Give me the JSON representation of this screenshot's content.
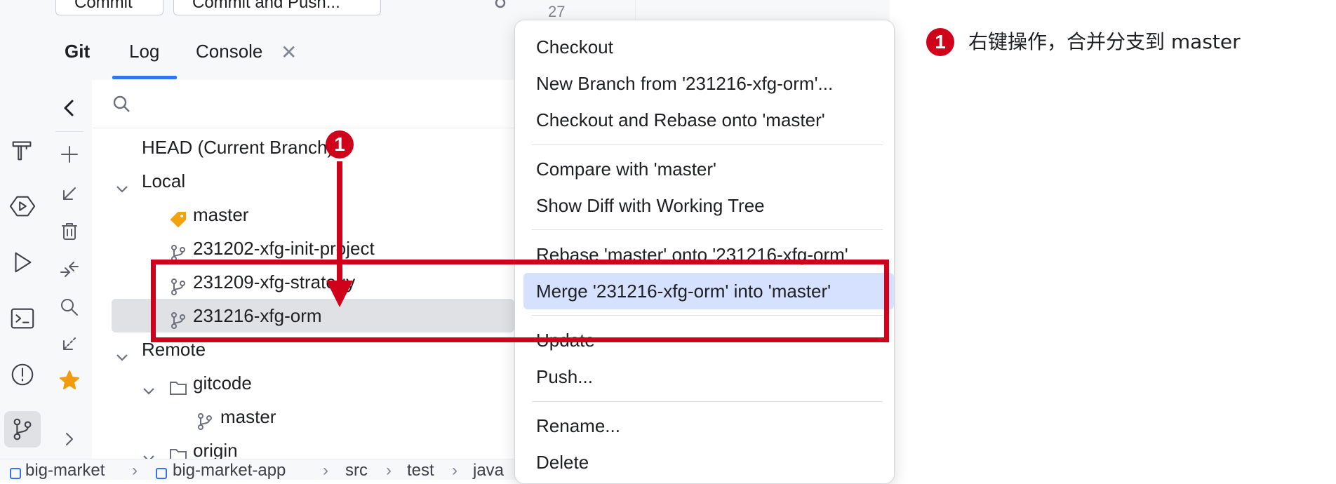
{
  "toolbar": {
    "commit_label": "Commit",
    "commit_push_label": "Commit and Push..."
  },
  "editor": {
    "line_number": "27"
  },
  "git_panel": {
    "tabs": [
      {
        "label": "Git"
      },
      {
        "label": "Log"
      },
      {
        "label": "Console"
      }
    ],
    "tree": {
      "head": "HEAD (Current Branch)",
      "local_label": "Local",
      "local_branches": [
        {
          "label": "master",
          "icon": "tag-icon"
        },
        {
          "label": "231202-xfg-init-project",
          "icon": "branch-icon"
        },
        {
          "label": "231209-xfg-strategy",
          "icon": "branch-icon"
        },
        {
          "label": "231216-xfg-orm",
          "icon": "branch-icon",
          "selected": true
        }
      ],
      "remote_label": "Remote",
      "remotes": [
        {
          "label": "gitcode",
          "branches": [
            "master"
          ]
        },
        {
          "label": "origin",
          "branches": []
        }
      ]
    }
  },
  "breadcrumb": [
    "big-market",
    "big-market-app",
    "src",
    "test",
    "java"
  ],
  "context_menu": {
    "items": [
      "Checkout",
      "New Branch from '231216-xfg-orm'...",
      "Checkout and Rebase onto 'master'",
      "Compare with 'master'",
      "Show Diff with Working Tree",
      "Rebase 'master' onto '231216-xfg-orm'",
      "Merge '231216-xfg-orm' into 'master'",
      "Update",
      "Push...",
      "Rename...",
      "Delete"
    ],
    "highlighted_index": 6
  },
  "annotation": {
    "number": "1",
    "text": "右键操作，合并分支到 master",
    "color": "#d0021b"
  },
  "colors": {
    "accent": "#3574f0",
    "selection": "#dfe1e5",
    "menu_highlight": "#d5e1ff",
    "tag_orange": "#f2a20d",
    "star_orange": "#f29b0d"
  }
}
